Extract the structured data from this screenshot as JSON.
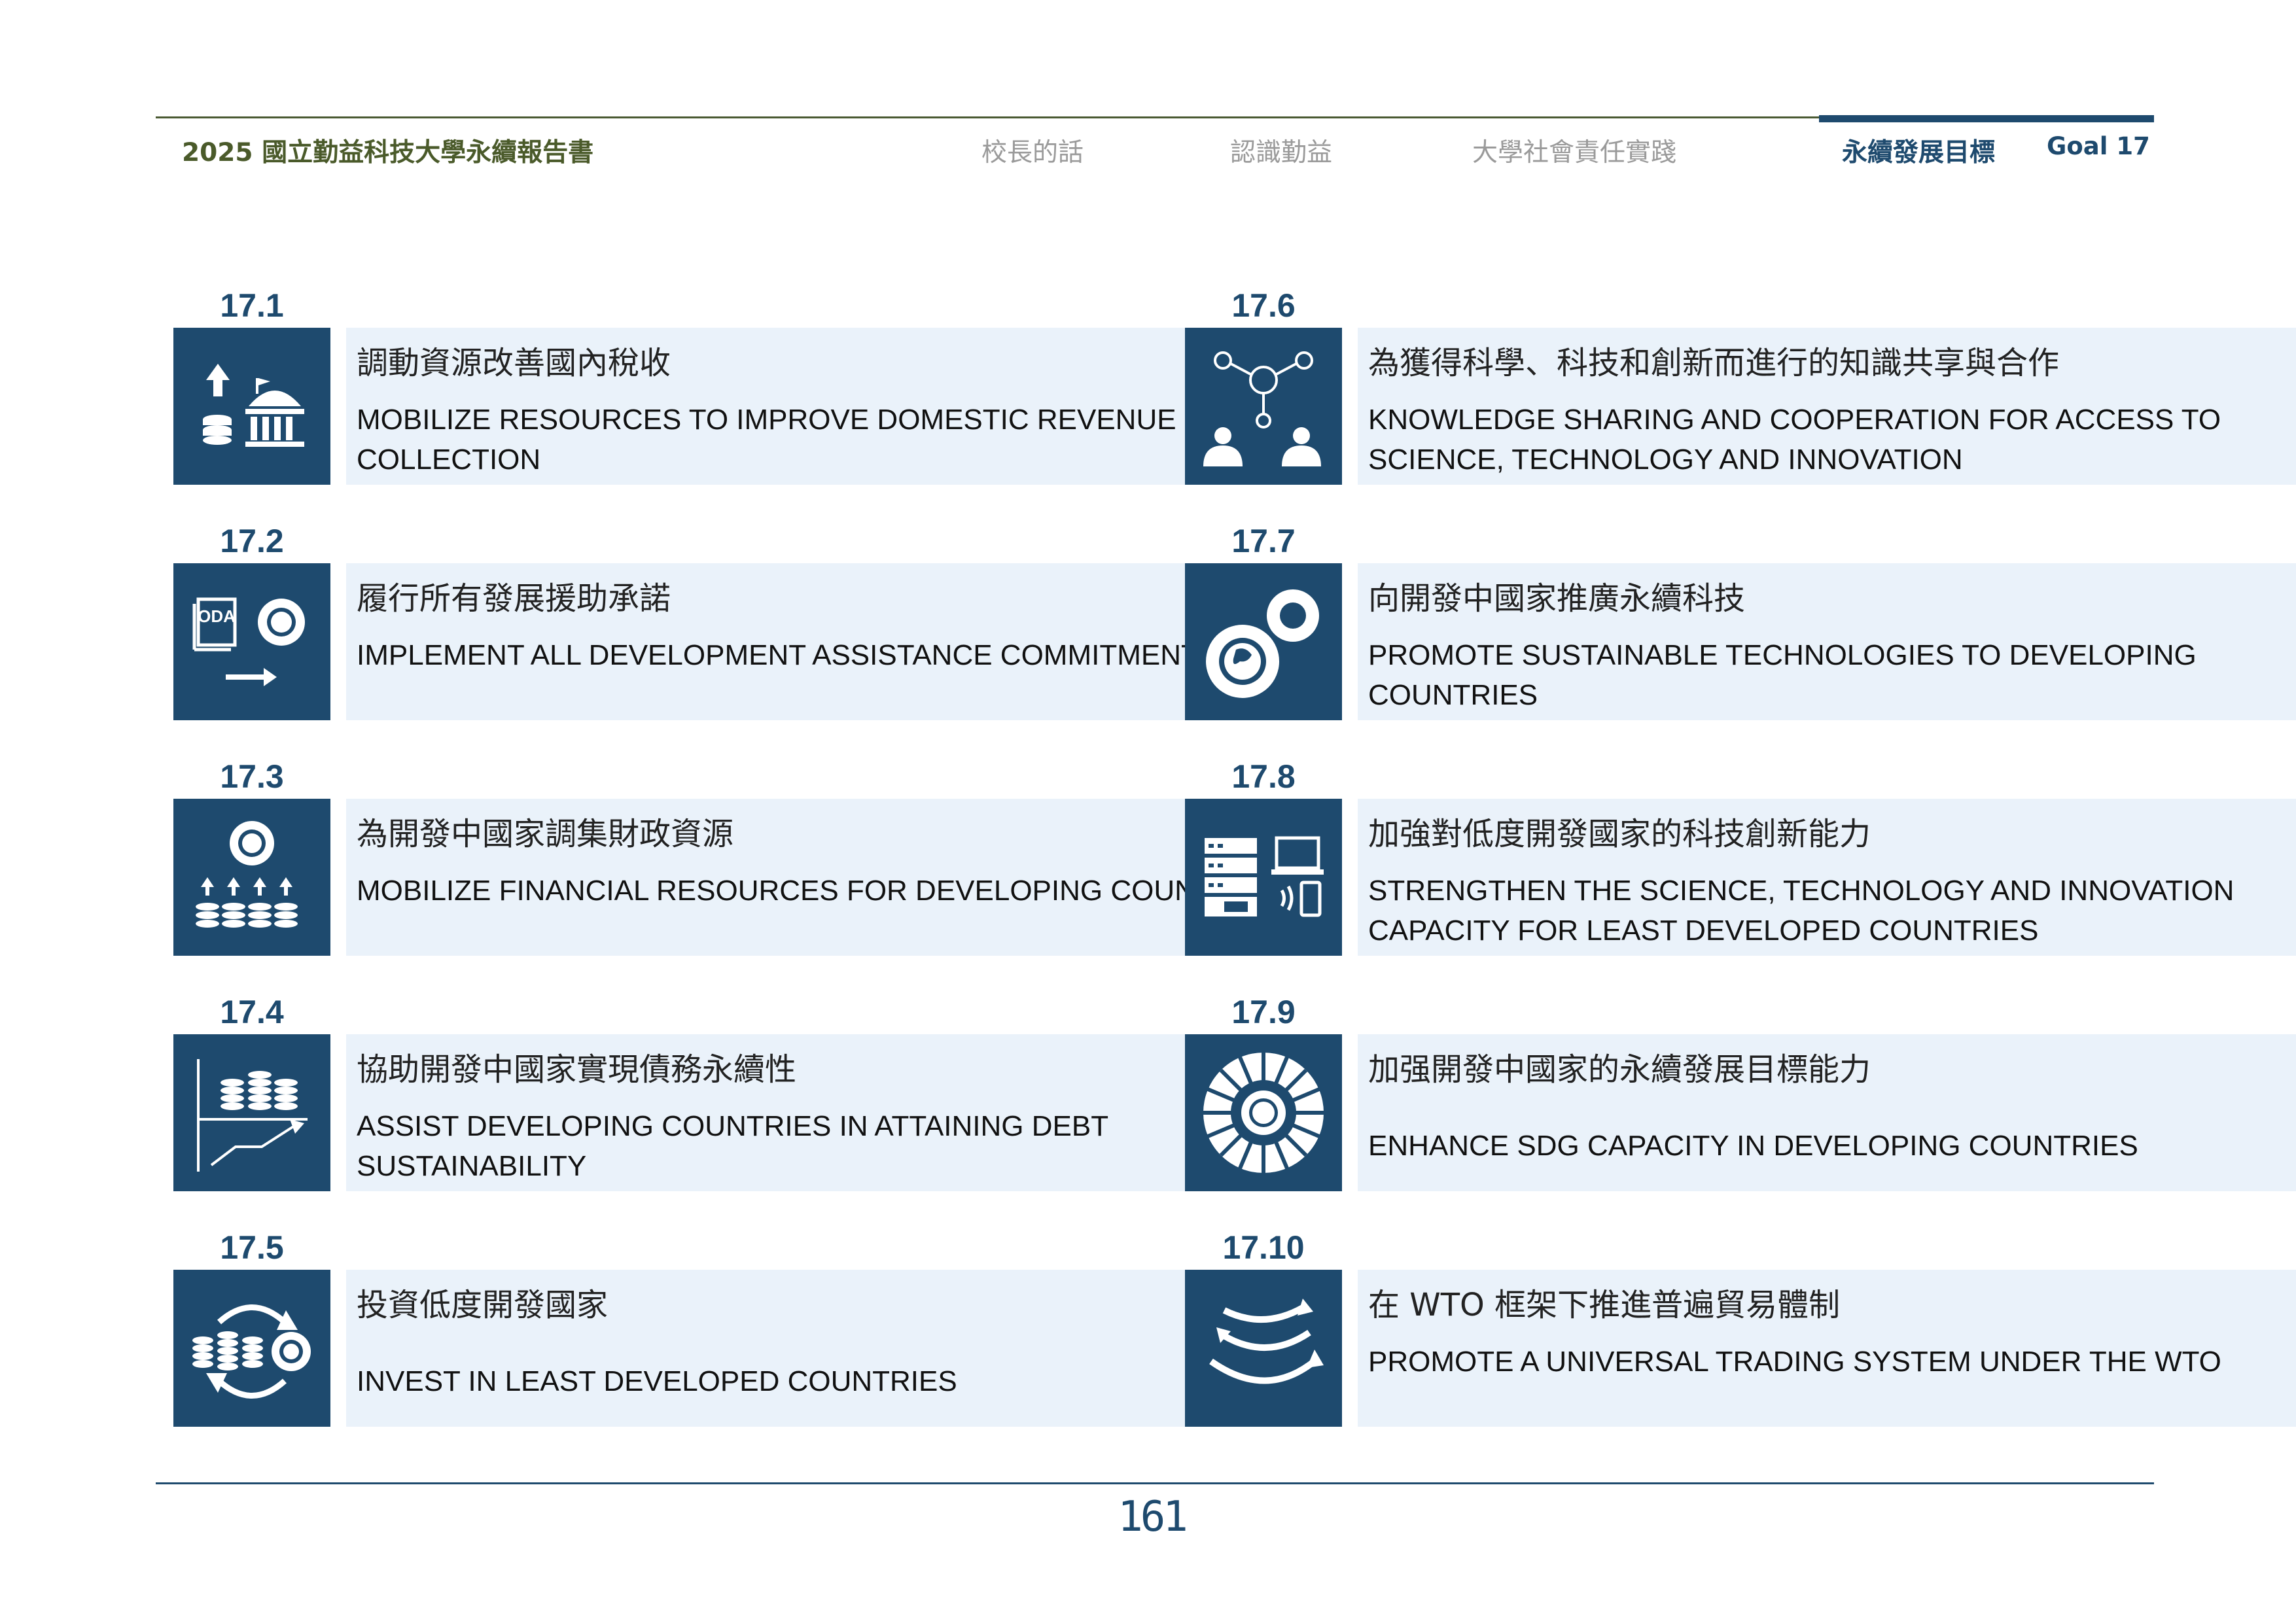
{
  "header": {
    "doc_title": "2025 國立勤益科技大學永續報告書",
    "nav": [
      "校長的話",
      "認識勤益",
      "大學社會責任實踐",
      "永續發展目標"
    ],
    "goal": "Goal 17"
  },
  "targets_left": [
    {
      "num": "17.1",
      "zh": "調動資源改善國內稅收",
      "en": "MOBILIZE RESOURCES TO IMPROVE DOMESTIC REVENUE COLLECTION",
      "icon": "revenue-building-icon"
    },
    {
      "num": "17.2",
      "zh": "履行所有發展援助承諾",
      "en": "IMPLEMENT ALL DEVELOPMENT ASSISTANCE COMMITMENTS",
      "icon": "oda-commitment-icon"
    },
    {
      "num": "17.3",
      "zh": "為開發中國家調集財政資源",
      "en": "MOBILIZE FINANCIAL RESOURCES FOR DEVELOPING COUNTRIES",
      "icon": "financial-resources-icon"
    },
    {
      "num": "17.4",
      "zh": "協助開發中國家實現債務永續性",
      "en": "ASSIST DEVELOPING COUNTRIES IN ATTAINING DEBT SUSTAINABILITY",
      "icon": "debt-chart-icon"
    },
    {
      "num": "17.5",
      "zh": "投資低度開發國家",
      "en": "INVEST IN LEAST DEVELOPED COUNTRIES",
      "icon": "invest-cycle-icon"
    }
  ],
  "targets_right": [
    {
      "num": "17.6",
      "zh": "為獲得科學、科技和創新而進行的知識共享與合作",
      "en": "KNOWLEDGE SHARING AND COOPERATION FOR ACCESS TO SCIENCE, TECHNOLOGY AND INNOVATION",
      "icon": "knowledge-network-icon"
    },
    {
      "num": "17.7",
      "zh": "向開發中國家推廣永續科技",
      "en": "PROMOTE SUSTAINABLE TECHNOLOGIES TO DEVELOPING COUNTRIES",
      "icon": "globe-gears-icon"
    },
    {
      "num": "17.8",
      "zh": "加強對低度開發國家的科技創新能力",
      "en": "STRENGTHEN THE SCIENCE, TECHNOLOGY AND INNOVATION CAPACITY FOR LEAST DEVELOPED COUNTRIES",
      "icon": "technology-devices-icon"
    },
    {
      "num": "17.9",
      "zh": "加强開發中國家的永續發展目標能力",
      "en": "ENHANCE SDG CAPACITY IN DEVELOPING COUNTRIES",
      "icon": "sdg-wheel-icon"
    },
    {
      "num": "17.10",
      "zh": "在 WTO 框架下推進普遍貿易體制",
      "en": "PROMOTE A UNIVERSAL TRADING SYSTEM UNDER THE WTO",
      "icon": "trade-arrows-icon"
    }
  ],
  "page_number": "161"
}
